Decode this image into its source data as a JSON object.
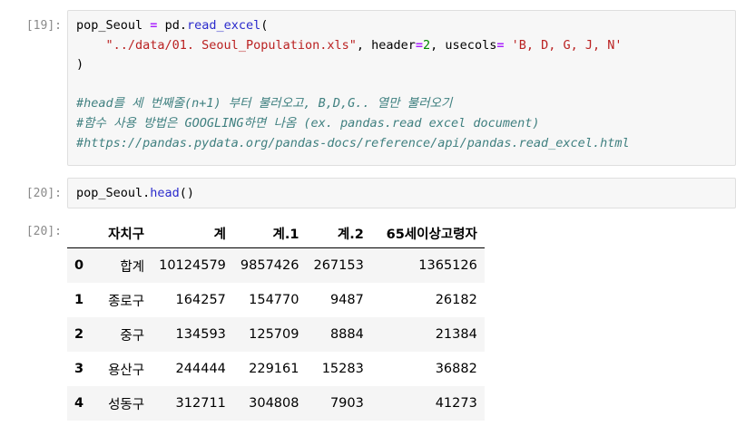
{
  "cells": [
    {
      "prompt": "[19]:",
      "code": {
        "line1": {
          "var": "pop_Seoul",
          "op": "=",
          "obj": "pd.",
          "fn": "read_excel",
          "paren": "("
        },
        "line2": {
          "arg_str": "\"../data/01. Seoul_Population.xls\"",
          "sep1": ", header",
          "eq1": "=",
          "num": "2",
          "sep2": ", usecols",
          "eq2": "=",
          "str2": "'B, D, G, J, N'"
        },
        "line3": ")",
        "comment1": "#head를 세 번째줄(n+1) 부터 불러오고, B,D,G.. 열만 불러오기",
        "comment2": "#함수 사용 방법은 GOOGLING하면 나옴 (ex. pandas.read excel document)",
        "comment3": "#https://pandas.pydata.org/pandas-docs/reference/api/pandas.read_excel.html"
      }
    },
    {
      "prompt": "[20]:",
      "code": {
        "obj": "pop_Seoul.",
        "fn": "head",
        "paren": "()"
      }
    }
  ],
  "output": {
    "prompt": "[20]:",
    "columns": [
      "",
      "자치구",
      "계",
      "계.1",
      "계.2",
      "65세이상고령자"
    ],
    "rows": [
      {
        "index": "0",
        "values": [
          "합계",
          "10124579",
          "9857426",
          "267153",
          "1365126"
        ]
      },
      {
        "index": "1",
        "values": [
          "종로구",
          "164257",
          "154770",
          "9487",
          "26182"
        ]
      },
      {
        "index": "2",
        "values": [
          "중구",
          "134593",
          "125709",
          "8884",
          "21384"
        ]
      },
      {
        "index": "3",
        "values": [
          "용산구",
          "244444",
          "229161",
          "15283",
          "36882"
        ]
      },
      {
        "index": "4",
        "values": [
          "성동구",
          "312711",
          "304808",
          "7903",
          "41273"
        ]
      }
    ]
  }
}
